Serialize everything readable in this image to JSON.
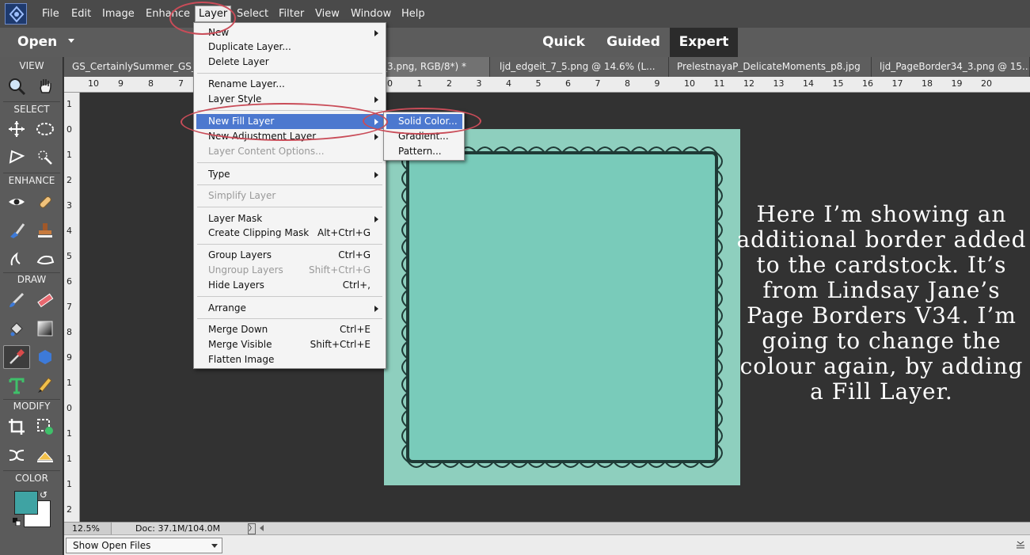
{
  "menubar": {
    "items": [
      "File",
      "Edit",
      "Image",
      "Enhance",
      "Layer",
      "Select",
      "Filter",
      "View",
      "Window",
      "Help"
    ],
    "active": "Layer"
  },
  "modebar": {
    "open_label": "Open",
    "tabs": [
      "Quick",
      "Guided",
      "Expert"
    ],
    "active_tab": "Expert"
  },
  "toolbox": {
    "sections": [
      "VIEW",
      "SELECT",
      "ENHANCE",
      "DRAW",
      "MODIFY",
      "COLOR"
    ],
    "tools": [
      "zoom-tool-icon",
      "hand-tool-icon",
      "move-tool-icon",
      "marquee-tool-icon",
      "lasso-tool-icon",
      "quick-selection-icon",
      "red-eye-icon",
      "spot-healing-icon",
      "smart-brush-icon",
      "clone-stamp-icon",
      "blur-tool-icon",
      "sponge-tool-icon",
      "brush-tool-icon",
      "eraser-tool-icon",
      "paint-bucket-icon",
      "gradient-tool-icon",
      "eyedropper-tool-icon",
      "custom-shape-icon",
      "type-tool-icon",
      "pencil-tool-icon",
      "crop-tool-icon",
      "recompose-tool-icon",
      "content-aware-move-icon",
      "straighten-tool-icon"
    ],
    "selected_tool": "eyedropper-tool-icon",
    "foreground_color": "#3fa3a3",
    "background_color": "#ffffff",
    "swap_glyph": "↺"
  },
  "doc_tabs": [
    "GS_CertainlySummer_GS_C",
    "_3.png, RGB/8*) *",
    "ljd_edgeit_7_5.png @ 14.6% (L...",
    "PrelestnayaP_DelicateMoments_p8.jpg",
    "ljd_PageBorder34_3.png @ 15..."
  ],
  "ruler_top": [
    "10",
    "9",
    "8",
    "7",
    "0",
    "1",
    "2",
    "3",
    "4",
    "5",
    "6",
    "7",
    "8",
    "9",
    "10",
    "11",
    "12",
    "13",
    "14",
    "15",
    "16",
    "17",
    "18",
    "19",
    "20"
  ],
  "ruler_left": [
    "1",
    "0",
    "1",
    "2",
    "3",
    "4",
    "5",
    "6",
    "7",
    "8",
    "9",
    "1",
    "0",
    "1",
    "1",
    "1",
    "2"
  ],
  "layer_menu": {
    "items": [
      {
        "label": "New",
        "submenu": true
      },
      {
        "label": "Duplicate Layer..."
      },
      {
        "label": "Delete Layer"
      },
      {
        "label": "Rename Layer..."
      },
      {
        "label": "Layer Style",
        "submenu": true
      },
      {
        "label": "New Fill Layer",
        "submenu": true,
        "highlight": true
      },
      {
        "label": "New Adjustment Layer",
        "submenu": true
      },
      {
        "label": "Layer Content Options...",
        "disabled": true
      },
      {
        "label": "Type",
        "submenu": true
      },
      {
        "label": "Simplify Layer",
        "disabled": true
      },
      {
        "label": "Layer Mask",
        "submenu": true
      },
      {
        "label": "Create Clipping Mask",
        "shortcut": "Alt+Ctrl+G"
      },
      {
        "label": "Group Layers",
        "shortcut": "Ctrl+G"
      },
      {
        "label": "Ungroup Layers",
        "shortcut": "Shift+Ctrl+G",
        "disabled": true
      },
      {
        "label": "Hide Layers",
        "shortcut": "Ctrl+,"
      },
      {
        "label": "Arrange",
        "submenu": true
      },
      {
        "label": "Merge Down",
        "shortcut": "Ctrl+E"
      },
      {
        "label": "Merge Visible",
        "shortcut": "Shift+Ctrl+E"
      },
      {
        "label": "Flatten Image"
      }
    ]
  },
  "fill_submenu": {
    "items": [
      "Solid Color...",
      "Gradient...",
      "Pattern..."
    ],
    "highlight": "Solid Color..."
  },
  "caption": "Here I’m showing an additional border added to the cardstock. It’s from Lindsay Jane’s Page Borders V34. I’m going to change the colour again, by adding a Fill Layer.",
  "status": {
    "zoom": "12.5%",
    "doc_size": "Doc: 37.1M/104.0M",
    "next_glyph": "〉"
  },
  "bottom": {
    "open_files_label": "Show Open Files"
  },
  "colors": {
    "annotation_oval": "#c94c58",
    "menu_highlight": "#4c78cf",
    "paper": "#8ecfbe"
  }
}
